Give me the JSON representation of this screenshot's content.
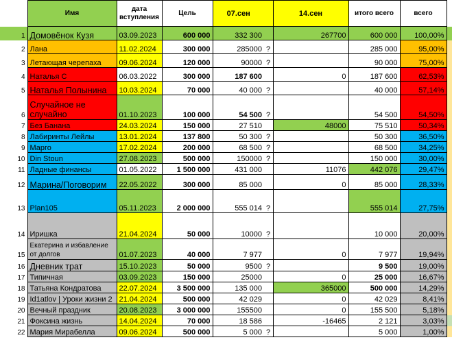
{
  "header": {
    "name": "Имя",
    "date_line1": "дата",
    "date_line2": "вступления",
    "goal": "Цель",
    "sep07": "07.сен",
    "sep14": "14.сен",
    "total": "итого всего",
    "all": "всего"
  },
  "rows": [
    {
      "n": "1",
      "name": "Домовёнок Кузя",
      "date": "03.09.2023",
      "goal": "600 000",
      "v07": "332 300",
      "q": "",
      "v14": "267700",
      "total": "600 000",
      "pct": "100,00%"
    },
    {
      "n": "2",
      "name": "Лана",
      "date": "11.02.2024",
      "goal": "300 000",
      "v07": "285000",
      "q": "?",
      "v14": "",
      "total": "285 000",
      "pct": "95,00%"
    },
    {
      "n": "3",
      "name": "Летающая черепаха",
      "date": "09.06.2024",
      "goal": "120 000",
      "v07": "90000",
      "q": "?",
      "v14": "",
      "total": "90 000",
      "pct": "75,00%"
    },
    {
      "n": "4",
      "name": "Наталья С",
      "date": "06.03.2022",
      "goal": "300 000",
      "v07": "187 600",
      "q": "",
      "v14": "0",
      "total": "187 600",
      "pct": "62,53%"
    },
    {
      "n": "5",
      "name": "Наталья Полынина",
      "date": "10.03.2024",
      "goal": "70 000",
      "v07": "40 000",
      "q": "?",
      "v14": "",
      "total": "40 000",
      "pct": "57,14%"
    },
    {
      "n": "6",
      "name": "Случайное не случайно",
      "date": "01.10.2023",
      "goal": "100 000",
      "v07": "54 500",
      "q": "?",
      "v14": "",
      "total": "54 500",
      "pct": "54,50%"
    },
    {
      "n": "7",
      "name": "Без Банана",
      "date": "24.03.2024",
      "goal": "150 000",
      "v07": "27 510",
      "q": "",
      "v14": "48000",
      "total": "75 510",
      "pct": "50,34%"
    },
    {
      "n": "8",
      "name": "Лабиринты Лейлы",
      "date": "13.01.2024",
      "goal": "137 800",
      "v07": "50 300",
      "q": "?",
      "v14": "",
      "total": "50 300",
      "pct": "36,50%"
    },
    {
      "n": "9",
      "name": "Марго",
      "date": "17.02.2024",
      "goal": "200 000",
      "v07": "68 500",
      "q": "?",
      "v14": "",
      "total": "68 500",
      "pct": "34,25%"
    },
    {
      "n": "10",
      "name": "Din Stoun",
      "date": "27.08.2023",
      "goal": "500 000",
      "v07": "150000",
      "q": "?",
      "v14": "",
      "total": "150 000",
      "pct": "30,00%"
    },
    {
      "n": "11",
      "name": "Ладные финансы",
      "date": "01.05.2022",
      "goal": "1 500 000",
      "v07": "431 000",
      "q": "",
      "v14": "11076",
      "total": "442 076",
      "pct": "29,47%"
    },
    {
      "n": "12",
      "name": "Марина/Поговорим",
      "date": "22.05.2022",
      "goal": "300 000",
      "v07": "85 000",
      "q": "",
      "v14": "0",
      "total": "85 000",
      "pct": "28,33%"
    },
    {
      "n": "13",
      "name": "Plan105",
      "date": "05.11.2023",
      "goal": "2 000 000",
      "v07": "555 014",
      "q": "?",
      "v14": "",
      "total": "555 014",
      "pct": "27,75%"
    },
    {
      "n": "14",
      "name": "Иришка",
      "date": "21.04.2024",
      "goal": "50 000",
      "v07": "10000",
      "q": "?",
      "v14": "",
      "total": "10 000",
      "pct": "20,00%"
    },
    {
      "n": "15",
      "name": "Екатерина и избавление от долгов",
      "date": "01.07.2023",
      "goal": "40 000",
      "v07": "7 977",
      "q": "",
      "v14": "0",
      "total": "7 977",
      "pct": "19,94%"
    },
    {
      "n": "16",
      "name": "Дневник трат",
      "date": "15.10.2023",
      "goal": "50 000",
      "v07": "9500",
      "q": "?",
      "v14": "",
      "total": "9 500",
      "pct": "19,00%"
    },
    {
      "n": "17",
      "name": "Типичная",
      "date": "03.09.2023",
      "goal": "150 000",
      "v07": "25000",
      "q": "",
      "v14": "0",
      "total": "25 000",
      "pct": "16,67%"
    },
    {
      "n": "18",
      "name": "Татьяна Кондратова",
      "date": "22.07.2024",
      "goal": "3 500 000",
      "v07": "135 000",
      "q": "",
      "v14": "365000",
      "total": "500 000",
      "pct": "14,29%"
    },
    {
      "n": "19",
      "name": "Id1atlov | Уроки жизни 2",
      "date": "21.04.2024",
      "goal": "500 000",
      "v07": "42 029",
      "q": "",
      "v14": "0",
      "total": "42 029",
      "pct": "8,41%"
    },
    {
      "n": "20",
      "name": "Вечный праздник",
      "date": "20.08.2023",
      "goal": "3 000 000",
      "v07": "155500",
      "q": "",
      "v14": "0",
      "total": "155 500",
      "pct": "5,18%"
    },
    {
      "n": "21",
      "name": "Фоксина жизнь",
      "date": "14.04.2024",
      "goal": "70 000",
      "v07": "18 586",
      "q": "",
      "v14": "-16465",
      "total": "2 121",
      "pct": "3,03%"
    },
    {
      "n": "22",
      "name": "Мария Мирабелла",
      "date": "09.06.2024",
      "goal": "500 000",
      "v07": "5 000",
      "q": "?",
      "v14": "",
      "total": "5 000",
      "pct": "1,00%"
    }
  ],
  "colors": {
    "green": "#92d050",
    "orange": "#ffc000",
    "red": "#ff0000",
    "blue": "#00b0f0",
    "grey": "#bfbfbf",
    "yellow": "#ffff00"
  }
}
